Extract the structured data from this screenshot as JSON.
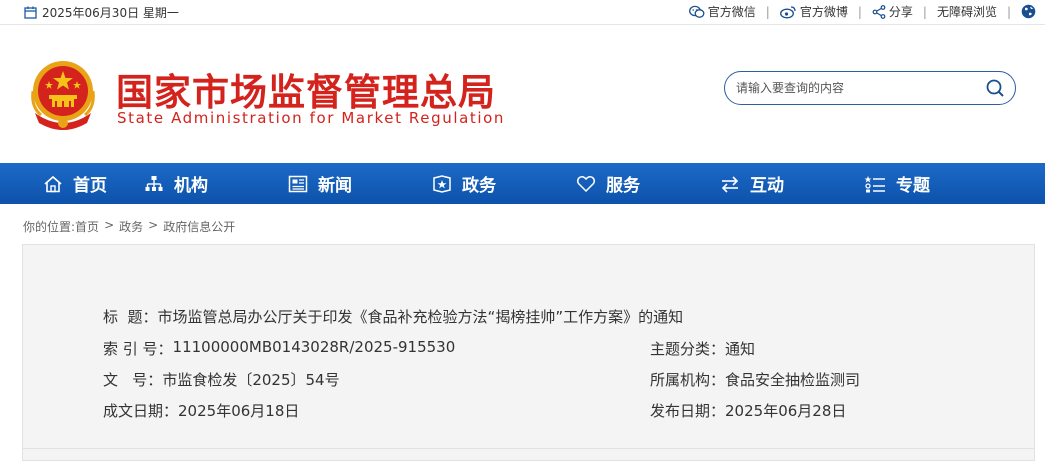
{
  "topbar": {
    "date": "2025年06月30日 星期一",
    "links": [
      {
        "label": "官方微信",
        "icon": "wechat-icon"
      },
      {
        "label": "官方微博",
        "icon": "weibo-icon"
      },
      {
        "label": "分享",
        "icon": "share-icon"
      },
      {
        "label": "无障碍浏览",
        "icon": ""
      }
    ],
    "separator": "|"
  },
  "header": {
    "title_cn": "国家市场监督管理总局",
    "title_en": "State Administration for Market Regulation"
  },
  "search": {
    "placeholder": "请输入要查询的内容"
  },
  "nav": {
    "items": [
      {
        "label": "首页",
        "icon": "home-icon"
      },
      {
        "label": "机构",
        "icon": "org-chart-icon"
      },
      {
        "label": "新闻",
        "icon": "news-icon"
      },
      {
        "label": "政务",
        "icon": "government-affairs-icon"
      },
      {
        "label": "服务",
        "icon": "heart-icon"
      },
      {
        "label": "互动",
        "icon": "exchange-arrows-icon"
      },
      {
        "label": "专题",
        "icon": "topic-icon"
      }
    ]
  },
  "breadcrumb": {
    "prefix": "你的位置:",
    "items": [
      "首页",
      "政务",
      "政府信息公开"
    ],
    "sep": ">"
  },
  "info": {
    "title_label": "标  题：",
    "title_value": "市场监管总局办公厅关于印发《食品补充检验方法“揭榜挂帅”工作方案》的通知",
    "index_label": "索 引 号：",
    "index_value": "11100000MB0143028R/2025-915530",
    "category_label": "主题分类：",
    "category_value": "通知",
    "docno_label": "文   号：",
    "docno_value": "市监食检发〔2025〕54号",
    "org_label": "所属机构：",
    "org_value": "食品安全抽检监测司",
    "created_label": "成文日期：",
    "created_value": "2025年06月18日",
    "published_label": "发布日期：",
    "published_value": "2025年06月28日"
  },
  "colors": {
    "brand_red": "#d4231c",
    "nav_blue": "#1260b9"
  }
}
